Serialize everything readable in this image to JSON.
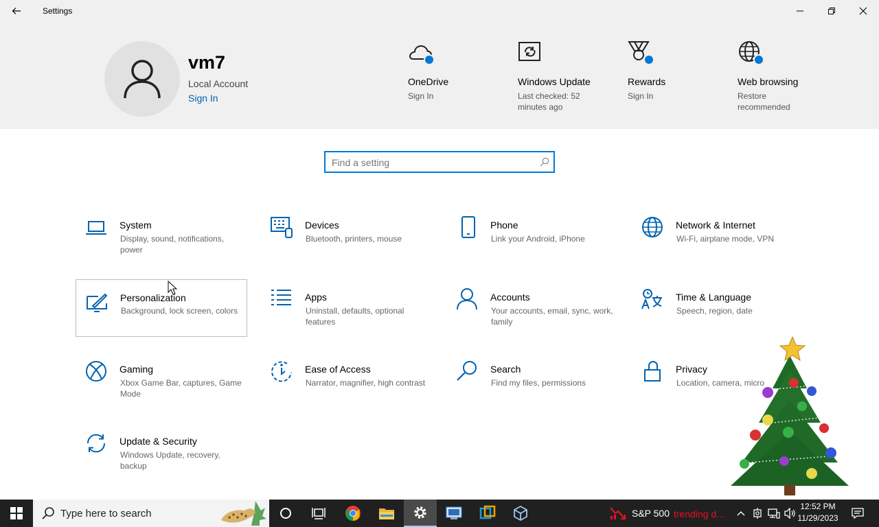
{
  "window": {
    "title": "Settings"
  },
  "account": {
    "name": "vm7",
    "type": "Local Account",
    "sign_in": "Sign In"
  },
  "header_items": [
    {
      "title": "OneDrive",
      "subtitle": "Sign In",
      "icon": "cloud-icon"
    },
    {
      "title": "Windows Update",
      "subtitle": "Last checked: 52 minutes ago",
      "icon": "sync-icon"
    },
    {
      "title": "Rewards",
      "subtitle": "Sign In",
      "icon": "medal-icon"
    },
    {
      "title": "Web browsing",
      "subtitle": "Restore recommended",
      "icon": "globe-icon"
    }
  ],
  "search": {
    "placeholder": "Find a setting"
  },
  "categories": [
    {
      "title": "System",
      "subtitle": "Display, sound, notifications, power",
      "icon": "laptop-icon"
    },
    {
      "title": "Devices",
      "subtitle": "Bluetooth, printers, mouse",
      "icon": "keyboard-icon"
    },
    {
      "title": "Phone",
      "subtitle": "Link your Android, iPhone",
      "icon": "phone-icon"
    },
    {
      "title": "Network & Internet",
      "subtitle": "Wi-Fi, airplane mode, VPN",
      "icon": "globe-icon"
    },
    {
      "title": "Personalization",
      "subtitle": "Background, lock screen, colors",
      "icon": "paint-icon"
    },
    {
      "title": "Apps",
      "subtitle": "Uninstall, defaults, optional features",
      "icon": "apps-list-icon"
    },
    {
      "title": "Accounts",
      "subtitle": "Your accounts, email, sync, work, family",
      "icon": "person-icon"
    },
    {
      "title": "Time & Language",
      "subtitle": "Speech, region, date",
      "icon": "language-icon"
    },
    {
      "title": "Gaming",
      "subtitle": "Xbox Game Bar, captures, Game Mode",
      "icon": "xbox-icon"
    },
    {
      "title": "Ease of Access",
      "subtitle": "Narrator, magnifier, high contrast",
      "icon": "ease-of-access-icon"
    },
    {
      "title": "Search",
      "subtitle": "Find my files, permissions",
      "icon": "search-icon"
    },
    {
      "title": "Privacy",
      "subtitle": "Location, camera, micro",
      "icon": "lock-icon"
    },
    {
      "title": "Update & Security",
      "subtitle": "Windows Update, recovery, backup",
      "icon": "sync-icon"
    }
  ],
  "taskbar": {
    "search_placeholder": "Type here to search",
    "news_title": "S&P 500",
    "news_trend": "trending d...",
    "time": "12:52 PM",
    "date": "11/29/2023"
  },
  "colors": {
    "accent": "#0078d7",
    "link": "#0063b1",
    "header_bg": "#f0f0f0",
    "taskbar_bg": "#202020"
  }
}
